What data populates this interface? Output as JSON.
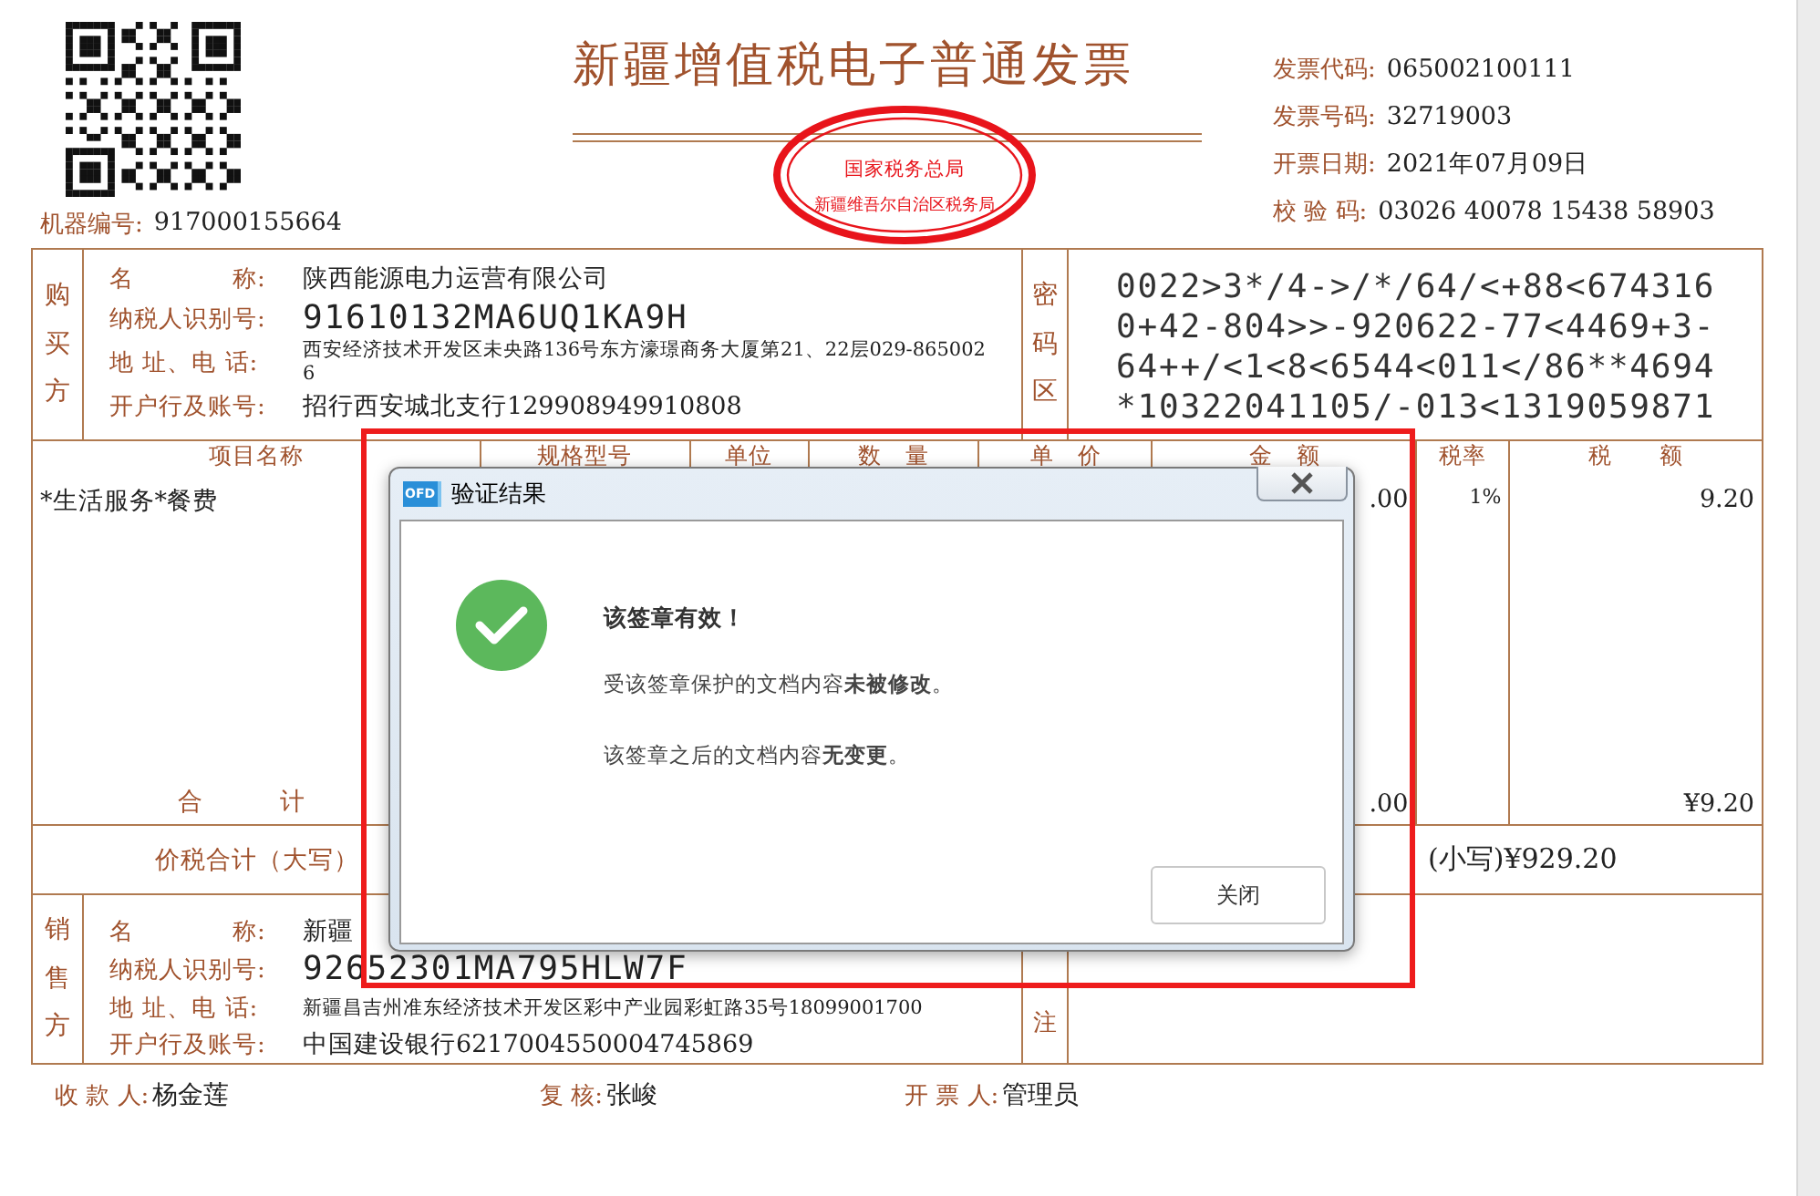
{
  "invoice": {
    "title": "新疆增值税电子普通发票",
    "machine_no": {
      "label": "机器编号:",
      "value": "917000155664"
    },
    "meta": [
      {
        "label": "发票代码:",
        "value": "065002100111"
      },
      {
        "label": "发票号码:",
        "value": "32719003"
      },
      {
        "label": "开票日期:",
        "value": "2021年07月09日"
      },
      {
        "label": "校 验 码:",
        "value": "03026 40078 15438 58903"
      }
    ],
    "stamp": {
      "center": "国家税务总局",
      "bottom": "新疆维吾尔自治区税务局"
    },
    "buyer": {
      "side": "购买方",
      "fields": [
        {
          "label": "名　　　　称:",
          "value": "陕西能源电力运营有限公司",
          "kind": "normal"
        },
        {
          "label": "纳税人识别号:",
          "value": "91610132MA6UQ1KA9H",
          "kind": "code"
        },
        {
          "label": "地 址、电 话:",
          "value": "西安经济技术开发区未央路136号东方濠璟商务大厦第21、22层029-8650026",
          "kind": "small"
        },
        {
          "label": "开户行及账号:",
          "value": "招行西安城北支行129908949910808",
          "kind": "normal"
        }
      ],
      "zone_label": "密码区",
      "cipher": [
        "0022>3*/4->/*/64/<+88<674316",
        "0+42-804>>-920622-77<4469+3-",
        "64++/<1<8<6544<011</86**4694",
        "*10322041105/-013<1319059871"
      ]
    },
    "items": {
      "columns": [
        "项目名称",
        "规格型号",
        "单位",
        "数　量",
        "单　价",
        "金　额",
        "税率",
        "税　　额"
      ],
      "rows": [
        {
          "name": "*生活服务*餐费",
          "amount": ".00",
          "rate": "1%",
          "tax": "9.20"
        }
      ],
      "total_label": "合　　　计",
      "total_amount": ".00",
      "total_tax": "¥9.20"
    },
    "grand_total": {
      "label": "价税合计（大写）",
      "small": "(小写)¥929.20"
    },
    "seller": {
      "side": "销售方",
      "fields": [
        {
          "label": "名　　　　称:",
          "value": "新疆",
          "kind": "normal"
        },
        {
          "label": "纳税人识别号:",
          "value": "92652301MA795HLW7F",
          "kind": "code"
        },
        {
          "label": "地 址、电 话:",
          "value": "新疆昌吉州准东经济技术开发区彩中产业园彩虹路35号18099001700",
          "kind": "small"
        },
        {
          "label": "开户行及账号:",
          "value": "中国建设银行6217004550004745869",
          "kind": "normal"
        }
      ],
      "zone_label": "注"
    },
    "footer": [
      {
        "label": "收 款 人:",
        "value": "杨金莲"
      },
      {
        "label": "复 核:",
        "value": "张峻"
      },
      {
        "label": "开 票 人:",
        "value": "管理员"
      }
    ]
  },
  "dialog": {
    "title": "验证结果",
    "app_icon_text": "OFD",
    "heading": "该签章有效！",
    "lines": [
      "受该签章保护的文档内容**未被修改**。",
      "该签章之后的文档内容**无变更**。"
    ],
    "button": "关闭"
  },
  "annotation": {
    "shown": true
  }
}
